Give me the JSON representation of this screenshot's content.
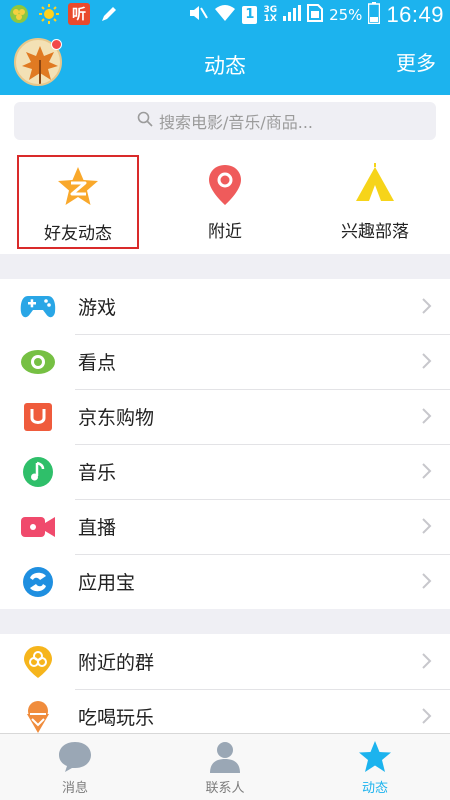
{
  "status_bar": {
    "battery_percent": "25%",
    "time": "16:49",
    "network_top": "3G",
    "network_bottom": "1X",
    "notif_badge": "1",
    "listen_app": "听"
  },
  "header": {
    "title": "动态",
    "more": "更多"
  },
  "search": {
    "placeholder": "搜索电影/音乐/商品..."
  },
  "quick_entries": [
    {
      "label": "好友动态",
      "icon": "qzone-star-icon",
      "highlighted": true
    },
    {
      "label": "附近",
      "icon": "location-pin-icon"
    },
    {
      "label": "兴趣部落",
      "icon": "tent-icon"
    }
  ],
  "section1": [
    {
      "label": "游戏",
      "icon": "gamepad-icon"
    },
    {
      "label": "看点",
      "icon": "eye-icon"
    },
    {
      "label": "京东购物",
      "icon": "jd-shopping-icon"
    },
    {
      "label": "音乐",
      "icon": "music-icon"
    },
    {
      "label": "直播",
      "icon": "video-camera-icon"
    },
    {
      "label": "应用宝",
      "icon": "app-store-icon"
    }
  ],
  "section2": [
    {
      "label": "附近的群",
      "icon": "nearby-group-icon"
    },
    {
      "label": "吃喝玩乐",
      "icon": "ice-cream-icon"
    }
  ],
  "tabs": [
    {
      "label": "消息",
      "icon": "chat-bubble-icon"
    },
    {
      "label": "联系人",
      "icon": "contact-person-icon"
    },
    {
      "label": "动态",
      "icon": "star-icon",
      "active": true
    }
  ],
  "colors": {
    "brand_blue": "#1cb3ee",
    "highlight_red": "#d92a2a"
  }
}
